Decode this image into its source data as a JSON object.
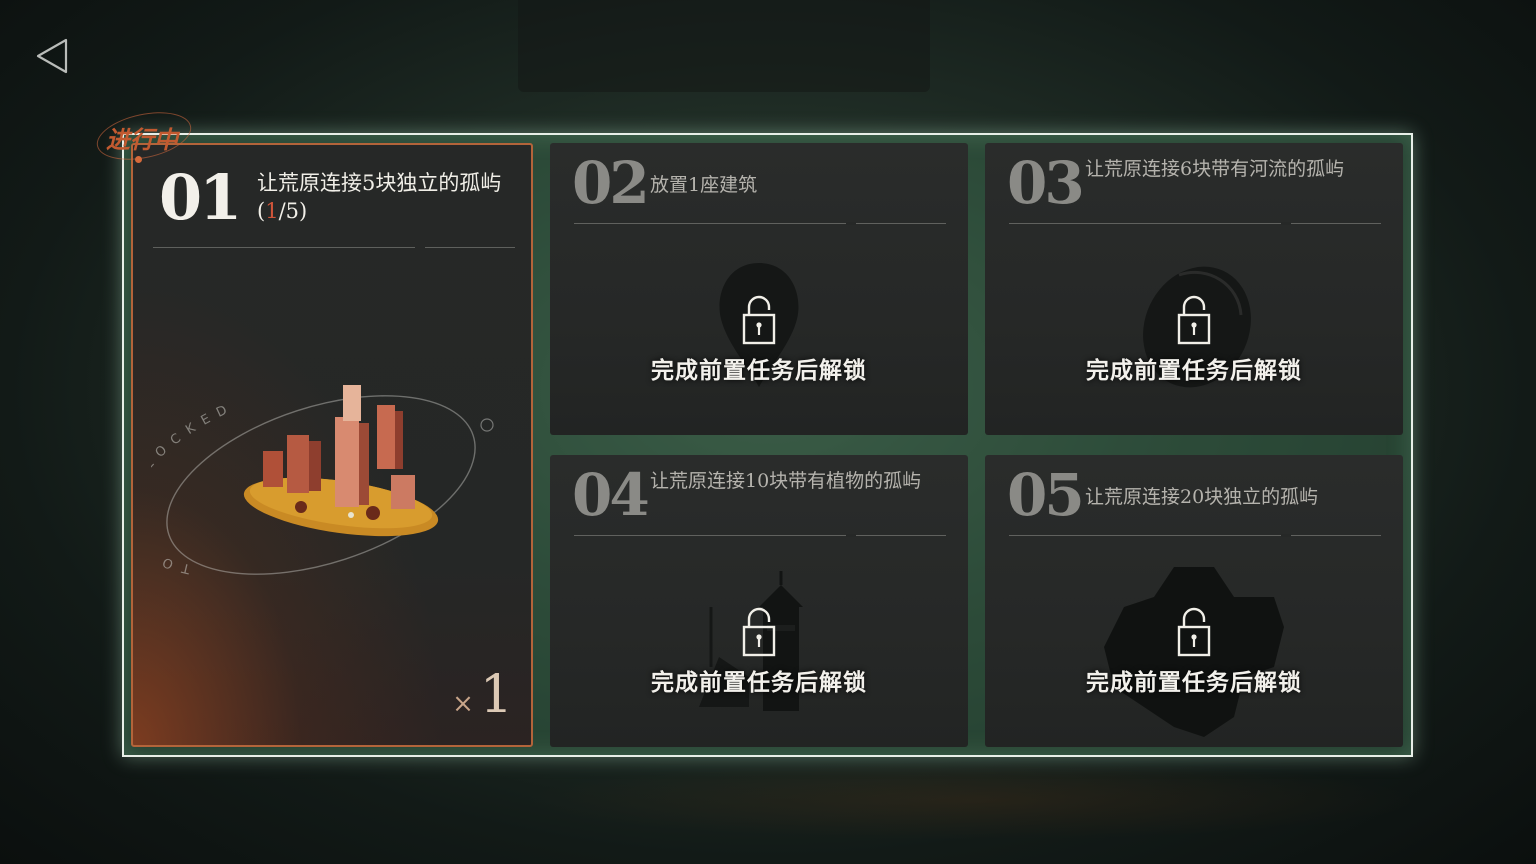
{
  "nav": {
    "back_icon": "back-triangle-icon"
  },
  "active_card": {
    "status": "进行中",
    "number": "01",
    "title_text": "让荒原连接5块独立的孤屿(",
    "progress_current": "1",
    "progress_sep_total": "/5)",
    "ring_text": "TO BE UNLOCKED",
    "reward_symbol": "×",
    "reward_count": "1"
  },
  "locked_cards": [
    {
      "number": "02",
      "title": "放置1座建筑",
      "unlock_text": "完成前置任务后解锁",
      "silhouette": "balloon-silhouette"
    },
    {
      "number": "03",
      "title": "让荒原连接6块带有河流的孤屿",
      "unlock_text": "完成前置任务后解锁",
      "silhouette": "shell-silhouette"
    },
    {
      "number": "04",
      "title": "让荒原连接10块带有植物的孤屿",
      "unlock_text": "完成前置任务后解锁",
      "silhouette": "lighthouse-silhouette"
    },
    {
      "number": "05",
      "title": "让荒原连接20块独立的孤屿",
      "unlock_text": "完成前置任务后解锁",
      "silhouette": "hexagon-silhouette"
    }
  ],
  "colors": {
    "accent_orange": "#d0553a",
    "frame_border": "#e8efe8",
    "card_bg": "#262827"
  }
}
